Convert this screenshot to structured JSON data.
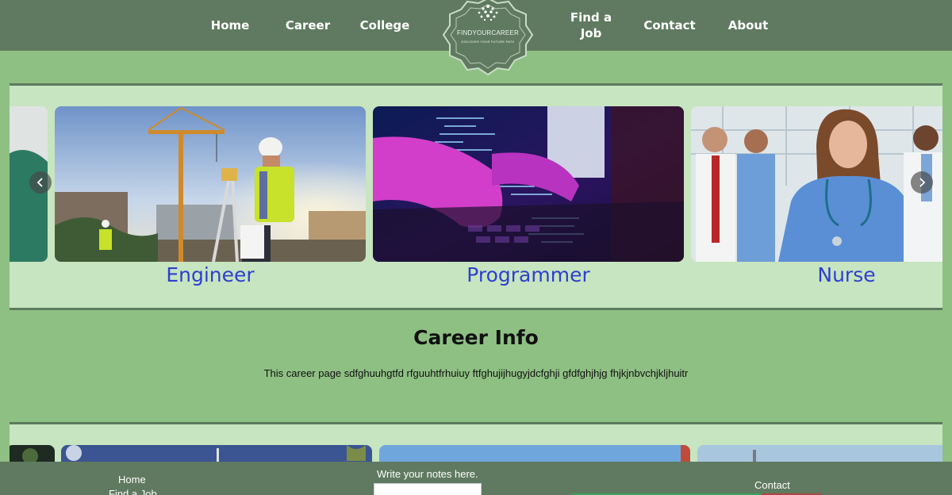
{
  "nav": {
    "home": "Home",
    "career": "Career",
    "college": "College",
    "find_a_job_line1": "Find a",
    "find_a_job_line2": "Job",
    "contact": "Contact",
    "about": "About"
  },
  "logo": {
    "title": "FINDYOURCAREER",
    "tagline": "DISCOVER YOUR FUTURE PATH"
  },
  "carousel": {
    "slides": [
      {
        "caption": "Engineer",
        "image": "construction-engineer-photo"
      },
      {
        "caption": "Programmer",
        "image": "keyboard-code-photo"
      },
      {
        "caption": "Nurse",
        "image": "medical-team-photo"
      }
    ],
    "prev_icon": "chevron-left-icon",
    "next_icon": "chevron-right-icon"
  },
  "career_info": {
    "title": "Career Info",
    "text": "This career page sdfghuuhgtfd rfguuhtfrhuiuy ftfghujijhugyjdcfghji gfdfghjhjg fhjkjnbvchjkljhuitr"
  },
  "footer": {
    "home": "Home",
    "find_a_job": "Find a Job",
    "notes_label": "Write your notes here.",
    "notes_value": "",
    "contact": "Contact"
  },
  "colors": {
    "page_bg": "#8ec083",
    "header_bg": "#5f7a60",
    "carousel_bg": "#c7e5c0",
    "caption_blue": "#2e3fcf"
  }
}
